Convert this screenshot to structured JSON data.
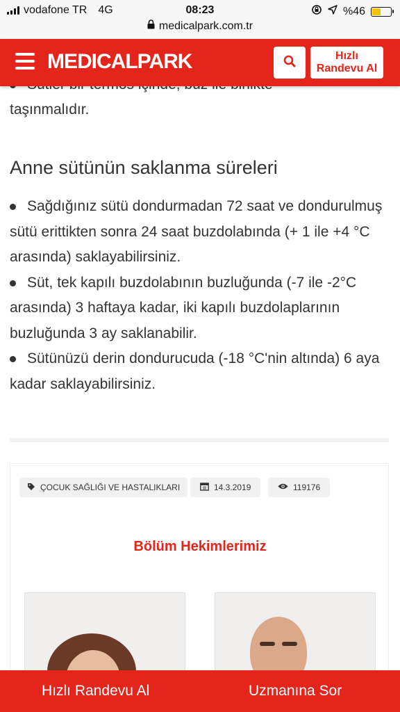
{
  "status": {
    "carrier": "vodafone TR",
    "network": "4G",
    "time": "08:23",
    "battery": "%46",
    "battery_level": 0.46,
    "url": "medicalpark.com.tr"
  },
  "header": {
    "logo": "MEDICALPARK",
    "quick_line1": "Hızlı",
    "quick_line2": "Randevu Al",
    "brand_color": "#e3251b"
  },
  "article": {
    "partial_line1": "Sütler bir termos içinde, buz ile birlikte",
    "partial_line2": "taşınmalıdır.",
    "heading": "Anne sütünün saklanma süreleri",
    "bullets": [
      "Sağdığınız sütü dondurmadan 72 saat ve dondurulmuş sütü erittikten sonra 24 saat buzdolabında (+ 1 ile +4 °C arasında) saklayabilirsiniz.",
      "Süt, tek kapılı buzdolabının buzluğunda (-7 ile -2°C arasında) 3 haftaya kadar, iki kapılı buzdolaplarının buzluğunda 3 ay saklanabilir.",
      "Sütünüzü derin dondurucuda (-18 °C'nin altında) 6 aya kadar saklayabilirsiniz."
    ]
  },
  "tags": {
    "category": "ÇOCUK SAĞLIĞI VE HASTALIKLARI",
    "date": "14.3.2019",
    "views": "119176"
  },
  "doctors": {
    "title": "Bölüm Hekimlerimiz"
  },
  "bottom_bar": {
    "left": "Hızlı Randevu Al",
    "right": "Uzmanına Sor"
  }
}
